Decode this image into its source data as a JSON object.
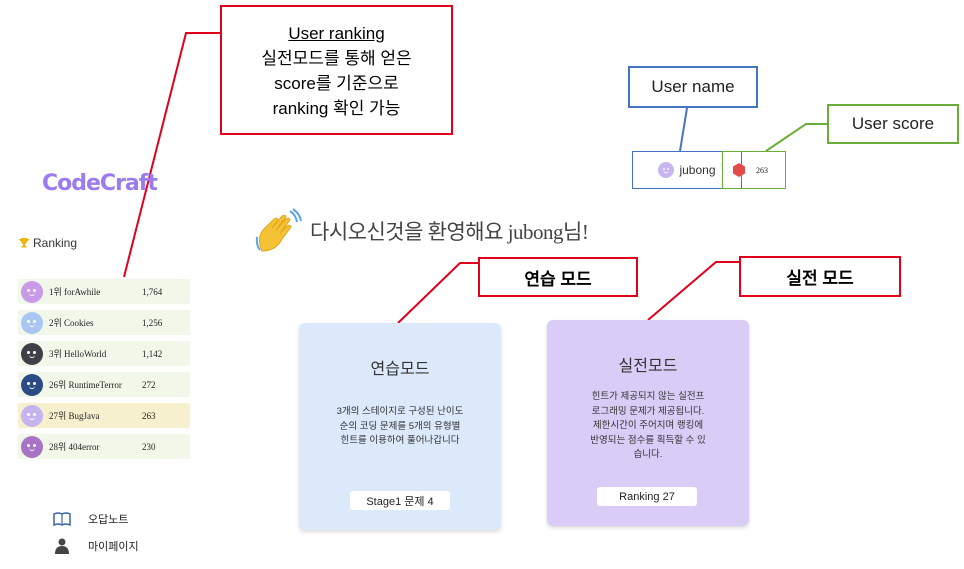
{
  "app": {
    "logo": "CodeCraft"
  },
  "ranking": {
    "header": "Ranking",
    "rows": [
      {
        "rank": "1위",
        "name": "forAwhile",
        "score": "1,764",
        "avatar_color": "#c79be8"
      },
      {
        "rank": "2위",
        "name": "Cookies",
        "score": "1,256",
        "avatar_color": "#a9c7f2"
      },
      {
        "rank": "3위",
        "name": "HelloWorld",
        "score": "1,142",
        "avatar_color": "#3d4147"
      },
      {
        "rank": "26위",
        "name": "RuntimeTerror",
        "score": "272",
        "avatar_color": "#2b4a86"
      },
      {
        "rank": "27위",
        "name": "BugJava",
        "score": "263",
        "avatar_color": "#c5b4ee",
        "highlight": true
      },
      {
        "rank": "28위",
        "name": "404error",
        "score": "230",
        "avatar_color": "#a873c4"
      }
    ]
  },
  "nav": {
    "wrong_note": "오답노트",
    "mypage": "마이페이지"
  },
  "user": {
    "name": "jubong",
    "score": "263",
    "score_color": "#e34a4a"
  },
  "welcome": {
    "text": "다시오신것을 환영해요 jubong님!"
  },
  "cards": {
    "practice": {
      "title": "연습모드",
      "desc_lines": [
        "3개의 스테이지로 구성된 난이도",
        "순의 코딩 문제를 5개의 유형별",
        "힌트를 이용하여 풀어나갑니다"
      ],
      "button": "Stage1 문제 4"
    },
    "battle": {
      "title": "실전모드",
      "desc_lines": [
        "힌트가 제공되지 않는 실전프",
        "로그래밍 문제가 제공됩니다.",
        "제한시간이 주어지며 랭킹에",
        "반영되는 점수를 획득할 수 있",
        "습니다."
      ],
      "button": "Ranking 27"
    }
  },
  "callouts": {
    "ranking_title": "User ranking",
    "ranking_lines": [
      "실전모드를 통해 얻은",
      "score를 기준으로",
      "ranking 확인 가능"
    ],
    "user_name": "User name",
    "user_score": "User score",
    "practice": "연습 모드",
    "battle": "실전 모드"
  },
  "colors": {
    "callout_red": "#e0001a",
    "callout_blue": "#4472c4",
    "callout_green": "#6aae3a",
    "logo": "#9b7cf0"
  }
}
